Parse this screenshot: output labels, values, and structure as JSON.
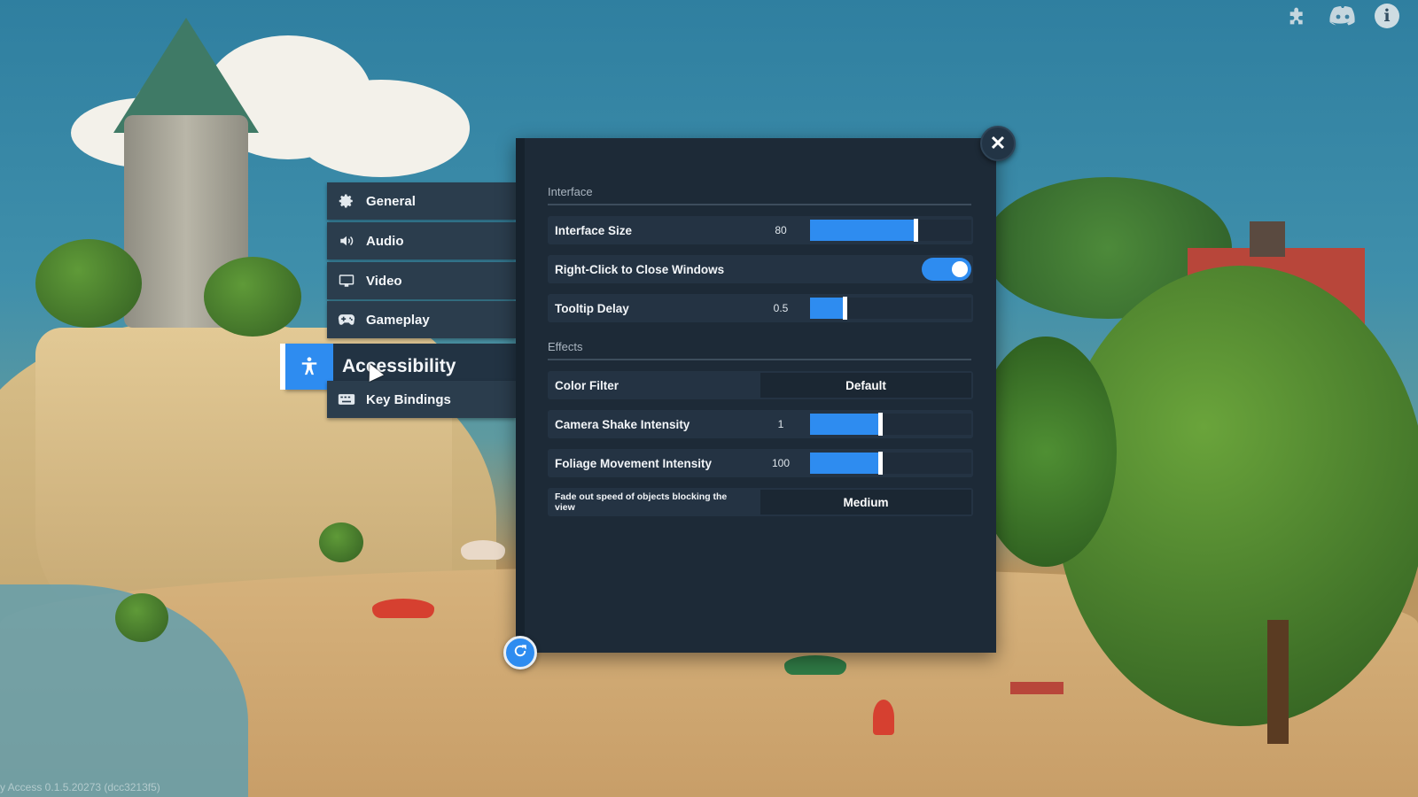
{
  "top_icons": [
    {
      "icon": "puzzle-icon"
    },
    {
      "icon": "discord-icon"
    },
    {
      "icon": "info-icon",
      "glyph": "i"
    }
  ],
  "menu": {
    "items": [
      {
        "label": "General",
        "icon": "gear-icon",
        "active": false
      },
      {
        "label": "Audio",
        "icon": "speaker-icon",
        "active": false
      },
      {
        "label": "Video",
        "icon": "monitor-icon",
        "active": false
      },
      {
        "label": "Gameplay",
        "icon": "gamepad-icon",
        "active": false
      },
      {
        "label": "Accessibility",
        "icon": "accessibility-icon",
        "active": true
      },
      {
        "label": "Key Bindings",
        "icon": "keyboard-icon",
        "active": false
      }
    ]
  },
  "panel": {
    "close_glyph": "✕",
    "sections": {
      "interface": {
        "title": "Interface",
        "interface_size": {
          "label": "Interface Size",
          "value": "80",
          "fraction": 0.66
        },
        "right_click": {
          "label": "Right-Click to Close Windows",
          "enabled": true
        },
        "tooltip_delay": {
          "label": "Tooltip Delay",
          "value": "0.5",
          "fraction": 0.22
        }
      },
      "effects": {
        "title": "Effects",
        "color_filter": {
          "label": "Color Filter",
          "value": "Default"
        },
        "camera_shake": {
          "label": "Camera Shake Intensity",
          "value": "1",
          "fraction": 0.44
        },
        "foliage": {
          "label": "Foliage Movement Intensity",
          "value": "100",
          "fraction": 0.44
        },
        "fade_out": {
          "label": "Fade out speed of objects blocking the view",
          "value": "Medium"
        }
      }
    }
  },
  "version_text": "y Access 0.1.5.20273 (dcc3213f5)",
  "colors": {
    "accent": "#2e8cf0",
    "panel": "#1d2a37",
    "row": "#243343"
  }
}
